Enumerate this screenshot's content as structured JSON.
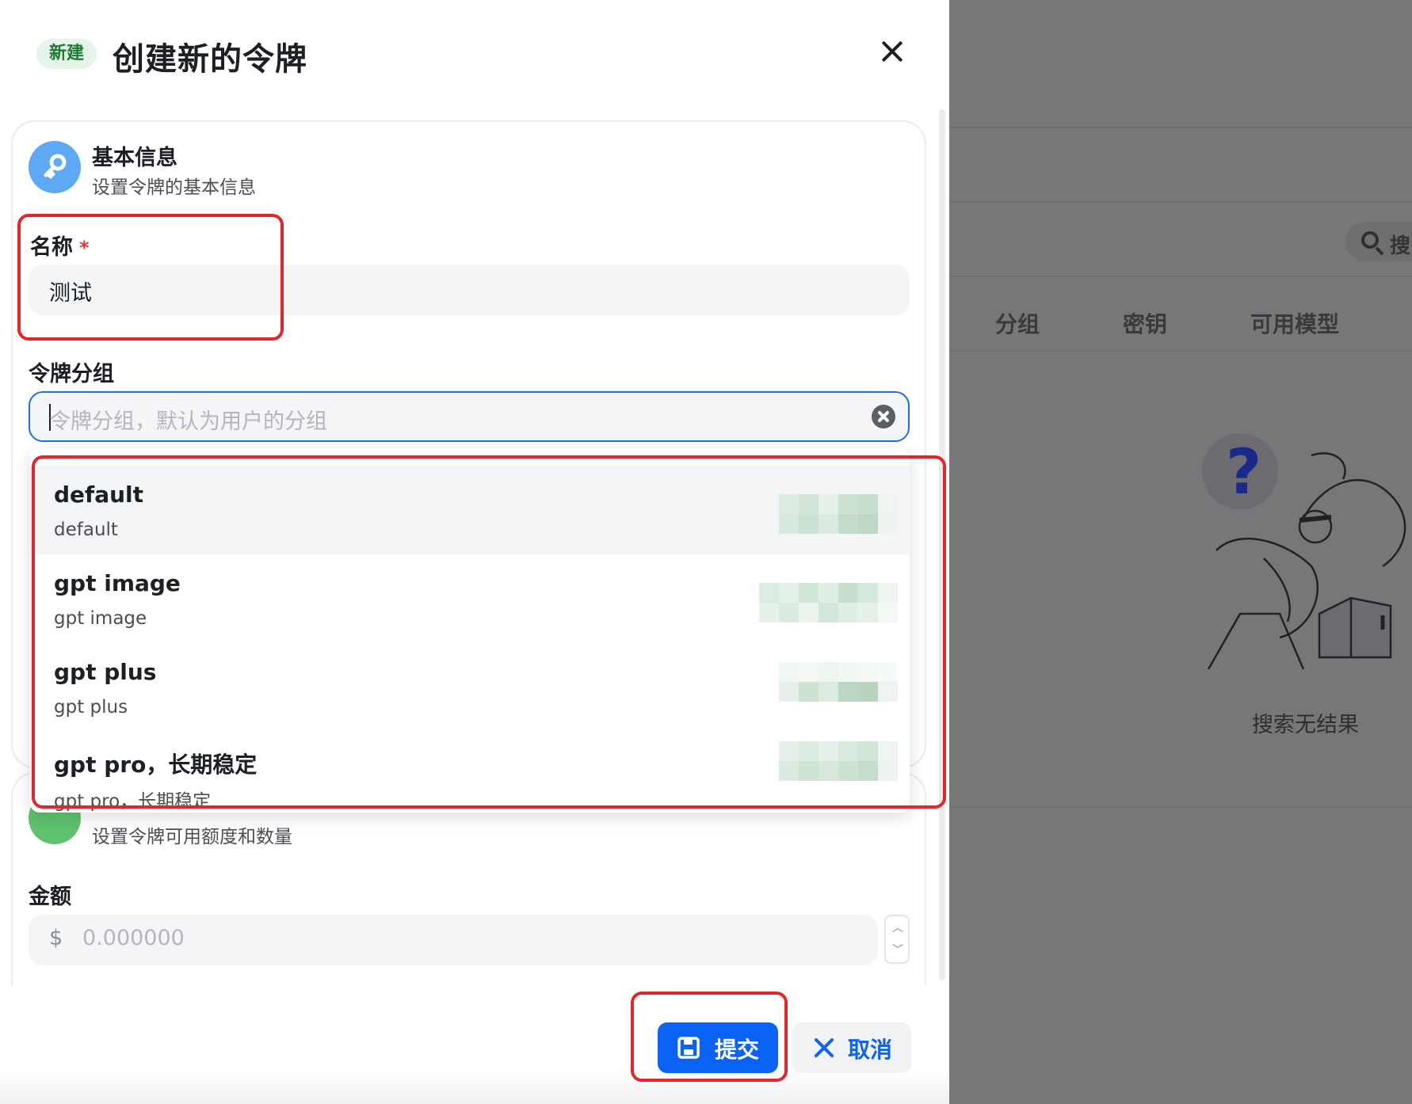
{
  "background": {
    "search_text": "搜",
    "columns": [
      "分组",
      "密钥",
      "可用模型"
    ],
    "empty_text": "搜索无结果"
  },
  "sheet": {
    "badge": "新建",
    "title": "创建新的令牌"
  },
  "basic_section": {
    "title": "基本信息",
    "subtitle": "设置令牌的基本信息"
  },
  "name_field": {
    "label": "名称",
    "required_mark": "*",
    "value": "测试"
  },
  "group_field": {
    "label": "令牌分组",
    "placeholder": "令牌分组，默认为用户的分组"
  },
  "group_options": [
    {
      "title": "default",
      "subtitle": "default"
    },
    {
      "title": "gpt image",
      "subtitle": "gpt image"
    },
    {
      "title": "gpt plus",
      "subtitle": "gpt plus"
    },
    {
      "title": "gpt pro，长期稳定",
      "subtitle": "gpt pro，长期稳定"
    }
  ],
  "quota_section": {
    "subtitle": "设置令牌可用额度和数量"
  },
  "amount_field": {
    "label": "金额",
    "prefix": "$",
    "placeholder": "0.000000"
  },
  "footer": {
    "submit_label": "提交",
    "cancel_label": "取消"
  },
  "colors": {
    "primary": "#0b63f6",
    "badge_bg": "#e6f5e9",
    "badge_text": "#1f7a34",
    "annotation_red": "#e3262b"
  }
}
